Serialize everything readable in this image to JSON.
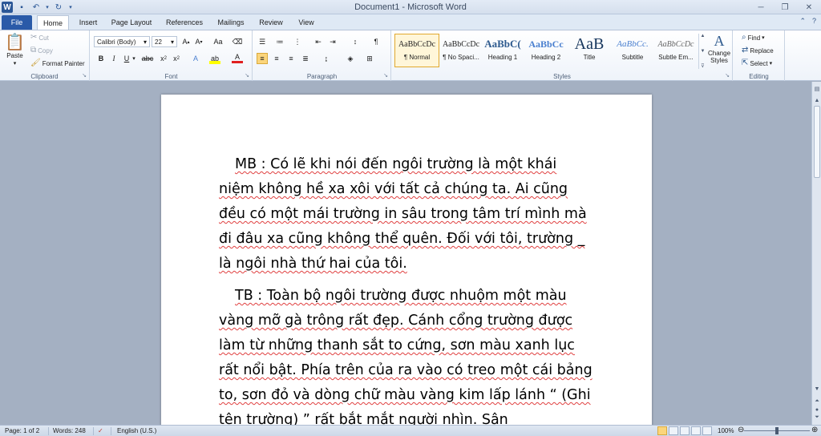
{
  "window": {
    "title": "Document1 - Microsoft Word",
    "logo_letter": "W"
  },
  "tabs": {
    "file": "File",
    "home": "Home",
    "insert": "Insert",
    "page_layout": "Page Layout",
    "references": "References",
    "mailings": "Mailings",
    "review": "Review",
    "view": "View"
  },
  "clipboard": {
    "paste": "Paste",
    "cut": "Cut",
    "copy": "Copy",
    "format_painter": "Format Painter",
    "label": "Clipboard"
  },
  "font": {
    "family": "Calibri (Body)",
    "size": "22",
    "label": "Font",
    "change_case": "Aa"
  },
  "paragraph": {
    "label": "Paragraph"
  },
  "styles": {
    "label": "Styles",
    "items": [
      {
        "preview": "AaBbCcDc",
        "name": "¶ Normal"
      },
      {
        "preview": "AaBbCcDc",
        "name": "¶ No Spaci..."
      },
      {
        "preview": "AaBbC(",
        "name": "Heading 1"
      },
      {
        "preview": "AaBbCc",
        "name": "Heading 2"
      },
      {
        "preview": "AaB",
        "name": "Title"
      },
      {
        "preview": "AaBbCc.",
        "name": "Subtitle"
      },
      {
        "preview": "AaBbCcDc",
        "name": "Subtle Em..."
      }
    ],
    "change_styles_line1": "Change",
    "change_styles_line2": "Styles"
  },
  "editing": {
    "find": "Find",
    "replace": "Replace",
    "select": "Select",
    "label": "Editing"
  },
  "document": {
    "paragraphs": [
      "MB : Có lẽ khi nói đến ngôi trường là một khái niệm không hề xa xôi với tất cả chúng ta. Ai cũng đều có một mái trường in sâu trong tâm trí mình mà đi đâu xa cũng không thể quên. Đối với tôi, trường _ là ngôi nhà thứ hai của tôi.",
      "TB : Toàn bộ ngôi trường được nhuộm một màu vàng mỡ gà trông rất đẹp. Cánh cổng trường được làm từ những thanh sắt to cứng, sơn màu xanh lục rất nổi bật. Phía trên của ra vào có treo một cái bảng to, sơn đỏ và dòng chữ màu vàng kim lấp lánh “  (Ghi tên trường)    ” rất bắt mắt người nhìn. Sân"
    ]
  },
  "status": {
    "page": "Page: 1 of 2",
    "words": "Words: 248",
    "language": "English (U.S.)",
    "zoom": "100%"
  }
}
